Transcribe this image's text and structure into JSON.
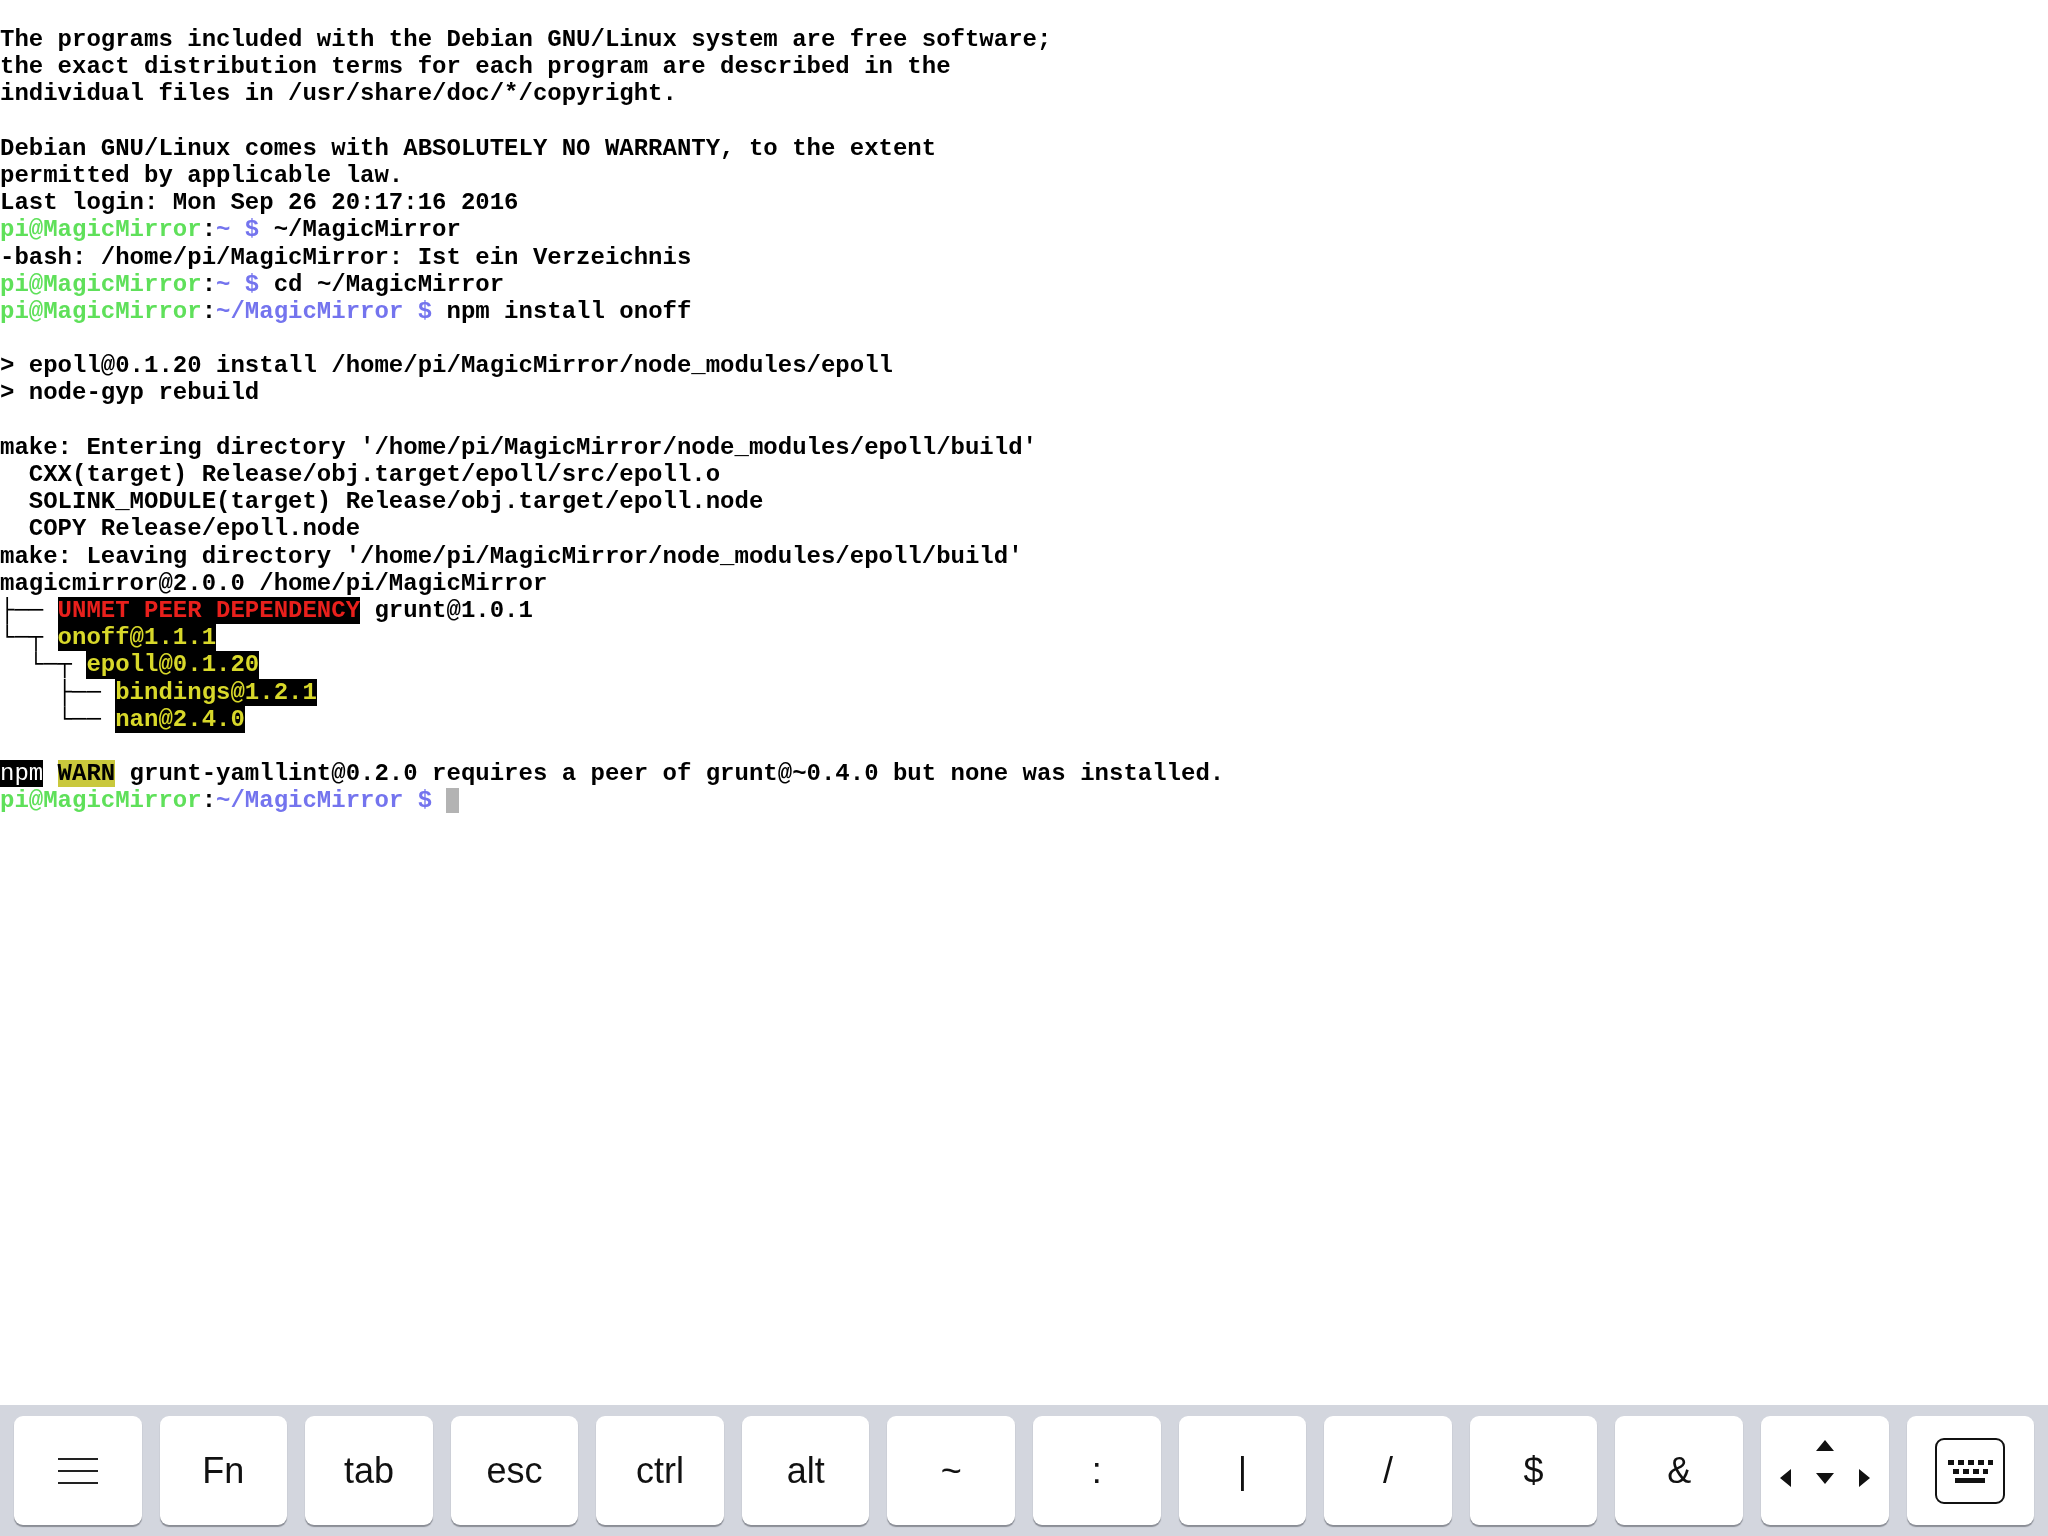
{
  "terminal": {
    "lines": [
      {
        "kind": "text",
        "segments": [
          {
            "kind": "plain",
            "text": "The programs included with the Debian GNU/Linux system are free software;"
          }
        ]
      },
      {
        "kind": "text",
        "segments": [
          {
            "kind": "plain",
            "text": "the exact distribution terms for each program are described in the"
          }
        ]
      },
      {
        "kind": "text",
        "segments": [
          {
            "kind": "plain",
            "text": "individual files in /usr/share/doc/*/copyright."
          }
        ]
      },
      {
        "kind": "blank"
      },
      {
        "kind": "text",
        "segments": [
          {
            "kind": "plain",
            "text": "Debian GNU/Linux comes with ABSOLUTELY NO WARRANTY, to the extent"
          }
        ]
      },
      {
        "kind": "text",
        "segments": [
          {
            "kind": "plain",
            "text": "permitted by applicable law."
          }
        ]
      },
      {
        "kind": "text",
        "segments": [
          {
            "kind": "plain",
            "text": "Last login: Mon Sep 26 20:17:16 2016"
          }
        ]
      },
      {
        "kind": "text",
        "segments": [
          {
            "kind": "user",
            "text": "pi@MagicMirror"
          },
          {
            "kind": "plain",
            "text": ":"
          },
          {
            "kind": "path",
            "text": "~ $"
          },
          {
            "kind": "plain",
            "text": " ~/MagicMirror"
          }
        ]
      },
      {
        "kind": "text",
        "segments": [
          {
            "kind": "plain",
            "text": "-bash: /home/pi/MagicMirror: Ist ein Verzeichnis"
          }
        ]
      },
      {
        "kind": "text",
        "segments": [
          {
            "kind": "user",
            "text": "pi@MagicMirror"
          },
          {
            "kind": "plain",
            "text": ":"
          },
          {
            "kind": "path",
            "text": "~ $"
          },
          {
            "kind": "plain",
            "text": " cd ~/MagicMirror"
          }
        ]
      },
      {
        "kind": "text",
        "segments": [
          {
            "kind": "user",
            "text": "pi@MagicMirror"
          },
          {
            "kind": "plain",
            "text": ":"
          },
          {
            "kind": "path",
            "text": "~/MagicMirror $"
          },
          {
            "kind": "plain",
            "text": " npm install onoff"
          }
        ]
      },
      {
        "kind": "blank"
      },
      {
        "kind": "text",
        "segments": [
          {
            "kind": "plain",
            "text": "> epoll@0.1.20 install /home/pi/MagicMirror/node_modules/epoll"
          }
        ]
      },
      {
        "kind": "text",
        "segments": [
          {
            "kind": "plain",
            "text": "> node-gyp rebuild"
          }
        ]
      },
      {
        "kind": "blank"
      },
      {
        "kind": "text",
        "segments": [
          {
            "kind": "plain",
            "text": "make: Entering directory '/home/pi/MagicMirror/node_modules/epoll/build'"
          }
        ]
      },
      {
        "kind": "text",
        "segments": [
          {
            "kind": "plain",
            "text": "  CXX(target) Release/obj.target/epoll/src/epoll.o"
          }
        ]
      },
      {
        "kind": "text",
        "segments": [
          {
            "kind": "plain",
            "text": "  SOLINK_MODULE(target) Release/obj.target/epoll.node"
          }
        ]
      },
      {
        "kind": "text",
        "segments": [
          {
            "kind": "plain",
            "text": "  COPY Release/epoll.node"
          }
        ]
      },
      {
        "kind": "text",
        "segments": [
          {
            "kind": "plain",
            "text": "make: Leaving directory '/home/pi/MagicMirror/node_modules/epoll/build'"
          }
        ]
      },
      {
        "kind": "text",
        "segments": [
          {
            "kind": "plain",
            "text": "magicmirror@2.0.0 /home/pi/MagicMirror"
          }
        ]
      },
      {
        "kind": "text",
        "segments": [
          {
            "kind": "plain",
            "text": "├── "
          },
          {
            "kind": "error",
            "text": "UNMET PEER DEPENDENCY"
          },
          {
            "kind": "plain",
            "text": " grunt@1.0.1"
          }
        ]
      },
      {
        "kind": "text",
        "segments": [
          {
            "kind": "plain",
            "text": "└─┬ "
          },
          {
            "kind": "package",
            "text": "onoff@1.1.1"
          }
        ]
      },
      {
        "kind": "text",
        "segments": [
          {
            "kind": "plain",
            "text": "  └─┬ "
          },
          {
            "kind": "package",
            "text": "epoll@0.1.20"
          }
        ]
      },
      {
        "kind": "text",
        "segments": [
          {
            "kind": "plain",
            "text": "    ├── "
          },
          {
            "kind": "package",
            "text": "bindings@1.2.1"
          }
        ]
      },
      {
        "kind": "text",
        "segments": [
          {
            "kind": "plain",
            "text": "    └── "
          },
          {
            "kind": "package",
            "text": "nan@2.4.0"
          }
        ]
      },
      {
        "kind": "blank"
      },
      {
        "kind": "text",
        "segments": [
          {
            "kind": "npm",
            "text": "npm"
          },
          {
            "kind": "warn",
            "text": "WARN"
          },
          {
            "kind": "plain",
            "text": " grunt-yamllint@0.2.0 requires a peer of grunt@~0.4.0 but none was installed."
          }
        ]
      },
      {
        "kind": "prompt",
        "segments": [
          {
            "kind": "user",
            "text": "pi@MagicMirror"
          },
          {
            "kind": "plain",
            "text": ":"
          },
          {
            "kind": "path",
            "text": "~/MagicMirror $"
          }
        ]
      }
    ]
  },
  "key_bar": {
    "keys": [
      {
        "kind": "menu"
      },
      {
        "kind": "text",
        "label": "Fn"
      },
      {
        "kind": "text",
        "label": "tab"
      },
      {
        "kind": "text",
        "label": "esc"
      },
      {
        "kind": "text",
        "label": "ctrl"
      },
      {
        "kind": "text",
        "label": "alt"
      },
      {
        "kind": "text",
        "label": "~"
      },
      {
        "kind": "text",
        "label": ":"
      },
      {
        "kind": "text",
        "label": "|"
      },
      {
        "kind": "text",
        "label": "/"
      },
      {
        "kind": "text",
        "label": "$"
      },
      {
        "kind": "text",
        "label": "&"
      },
      {
        "kind": "arrows"
      },
      {
        "kind": "keyboard"
      }
    ]
  }
}
